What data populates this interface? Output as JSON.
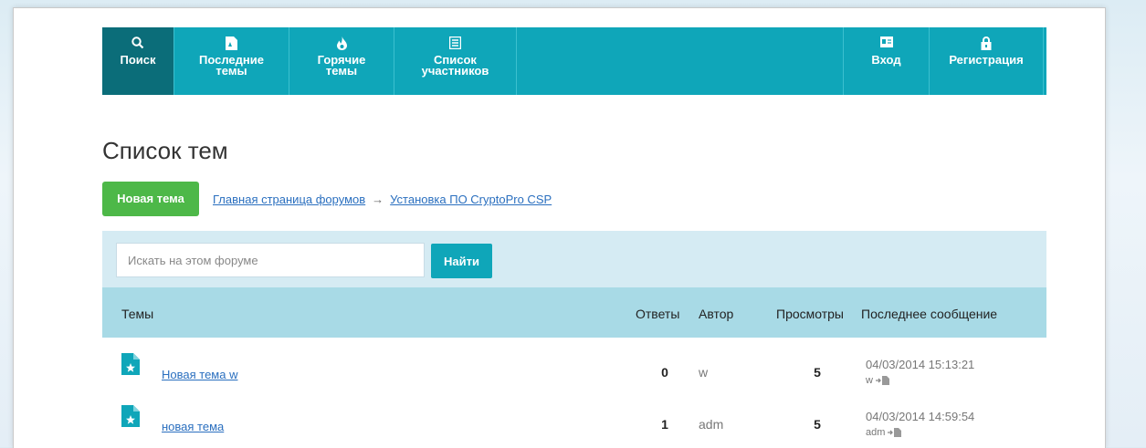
{
  "nav": {
    "items": [
      {
        "label": "Поиск",
        "icon": "search-icon"
      },
      {
        "label": "Последние\nтемы",
        "icon": "new-document-icon"
      },
      {
        "label": "Горячие\nтемы",
        "icon": "flame-icon"
      },
      {
        "label": "Список\nучастников",
        "icon": "list-icon"
      }
    ],
    "right_items": [
      {
        "label": "Вход",
        "icon": "id-card-icon"
      },
      {
        "label": "Регистрация",
        "icon": "lock-icon"
      }
    ]
  },
  "page": {
    "title": "Список тем"
  },
  "actions": {
    "new_topic_label": "Новая тема"
  },
  "breadcrumb": {
    "items": [
      "Главная страница форумов",
      "Установка ПО CryptoPro CSP"
    ],
    "separator": "→"
  },
  "search": {
    "placeholder": "Искать на этом форуме",
    "button_label": "Найти"
  },
  "table": {
    "headers": {
      "topics": "Темы",
      "replies": "Ответы",
      "author": "Автор",
      "views": "Просмотры",
      "last_post": "Последнее сообщение"
    },
    "rows": [
      {
        "title": "Новая тема w",
        "replies": "0",
        "author": "w",
        "views": "5",
        "last_date": "04/03/2014 15:13:21",
        "last_user": "w"
      },
      {
        "title": "новая тема",
        "replies": "1",
        "author": "adm",
        "views": "5",
        "last_date": "04/03/2014 14:59:54",
        "last_user": "adm"
      }
    ]
  },
  "colors": {
    "nav": "#0fa6b9",
    "nav_active": "#0b6d79",
    "new_button": "#4db848",
    "search_bg": "#d5ebf3",
    "header_bg": "#a8dae6",
    "link": "#2a6fbf"
  }
}
